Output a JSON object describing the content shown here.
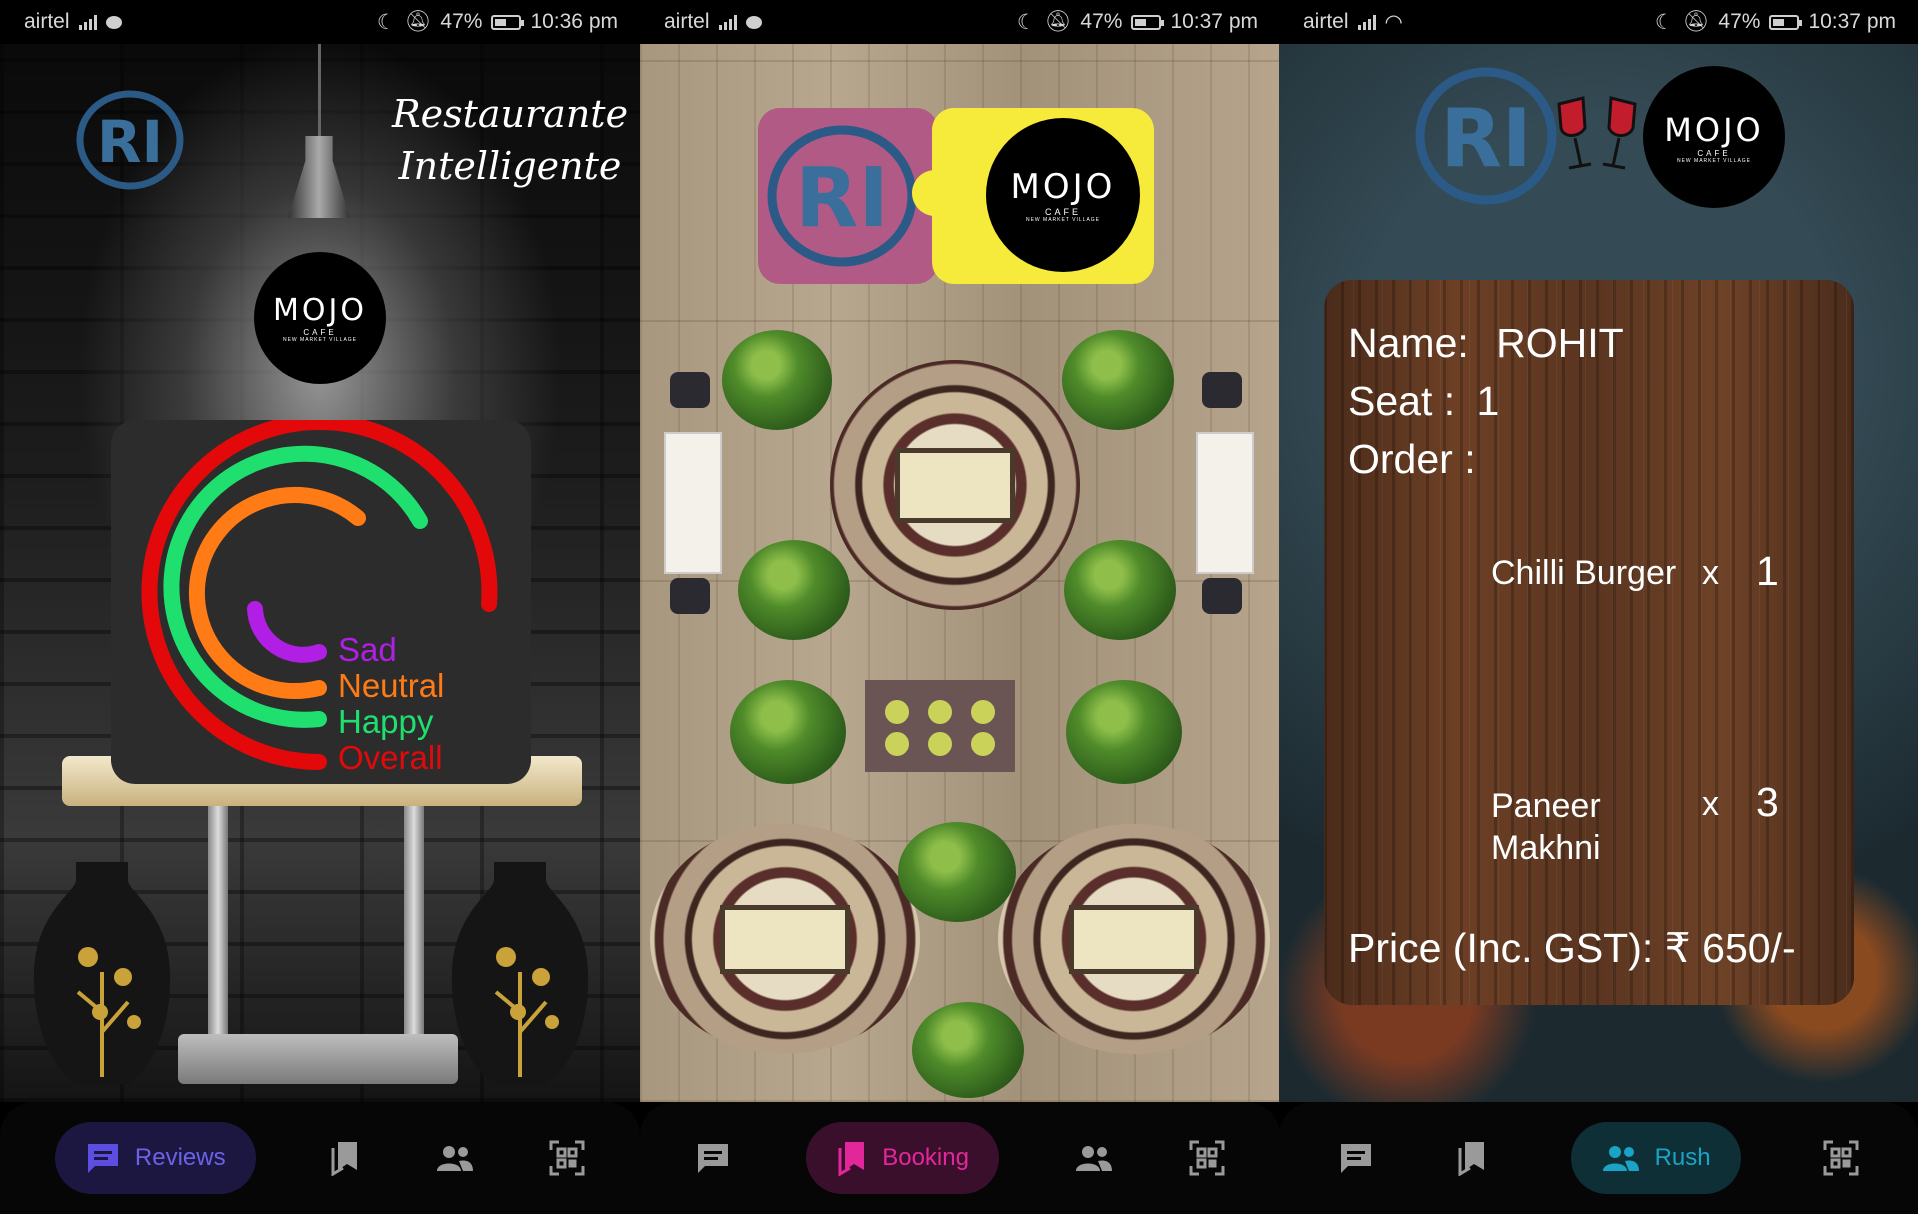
{
  "status_bars": [
    {
      "carrier": "airtel",
      "battery": "47%",
      "time": "10:36 pm"
    },
    {
      "carrier": "airtel",
      "battery": "47%",
      "time": "10:37 pm"
    },
    {
      "carrier": "airtel",
      "battery": "47%",
      "time": "10:37 pm"
    }
  ],
  "brand": {
    "logo_monogram": "RI",
    "name_line1": "Restaurante",
    "name_line2": "Intelligente",
    "partner_name": "MOJO",
    "partner_sub": "CAFE",
    "partner_tagline": "NEW MARKET VILLAGE"
  },
  "reviews": {
    "legend": [
      {
        "label": "Sad",
        "color": "#b11fe5"
      },
      {
        "label": "Neutral",
        "color": "#ff7b16"
      },
      {
        "label": "Happy",
        "color": "#1fe06e"
      },
      {
        "label": "Overall",
        "color": "#e3090a"
      }
    ]
  },
  "order": {
    "name_label": "Name:",
    "name_value": "ROHIT",
    "seat_label": "Seat :",
    "seat_value": "1",
    "order_label": "Order :",
    "items": [
      {
        "name": "Chilli Burger",
        "x": "x",
        "qty": "1"
      },
      {
        "name": "Paneer Makhni",
        "x": "x",
        "qty": "3"
      }
    ],
    "price_label": "Price (Inc. GST):",
    "price_value": "₹ 650/-"
  },
  "nav": {
    "reviews_label": "Reviews",
    "booking_label": "Booking",
    "rush_label": "Rush",
    "icons": [
      "chat-icon",
      "bookmark-icon",
      "people-icon",
      "qr-scan-icon"
    ],
    "active_colors": {
      "reviews": "#3d2fb0",
      "booking": "#e2279a",
      "rush": "#1aa3c6"
    }
  }
}
